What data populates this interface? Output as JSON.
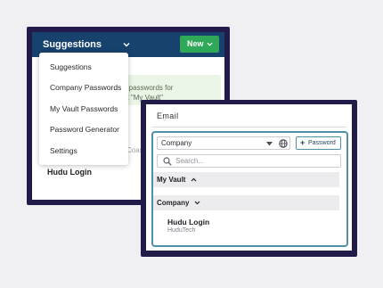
{
  "back_panel": {
    "header": {
      "title": "Suggestions",
      "new_button": "New"
    },
    "info_text": {
      "line1": "o passwords for",
      "line2": "at \"My Vault\""
    },
    "partial_text": "Coast",
    "entry": "Hudu Login"
  },
  "dropdown": {
    "items": [
      "Suggestions",
      "Company Passwords",
      "My Vault Passwords",
      "Password Generator",
      "Settings"
    ]
  },
  "front_panel": {
    "email_label": "Email",
    "company_select": "Company",
    "add_password_button": "Password",
    "search_placeholder": "Search...",
    "sections": {
      "my_vault": "My Vault",
      "company": "Company"
    },
    "entry": {
      "name": "Hudu Login",
      "company": "HuduTech"
    }
  },
  "colors": {
    "frame": "#211b4a",
    "header": "#17426e",
    "new_button": "#2fa857",
    "accent": "#4f8fa8"
  }
}
